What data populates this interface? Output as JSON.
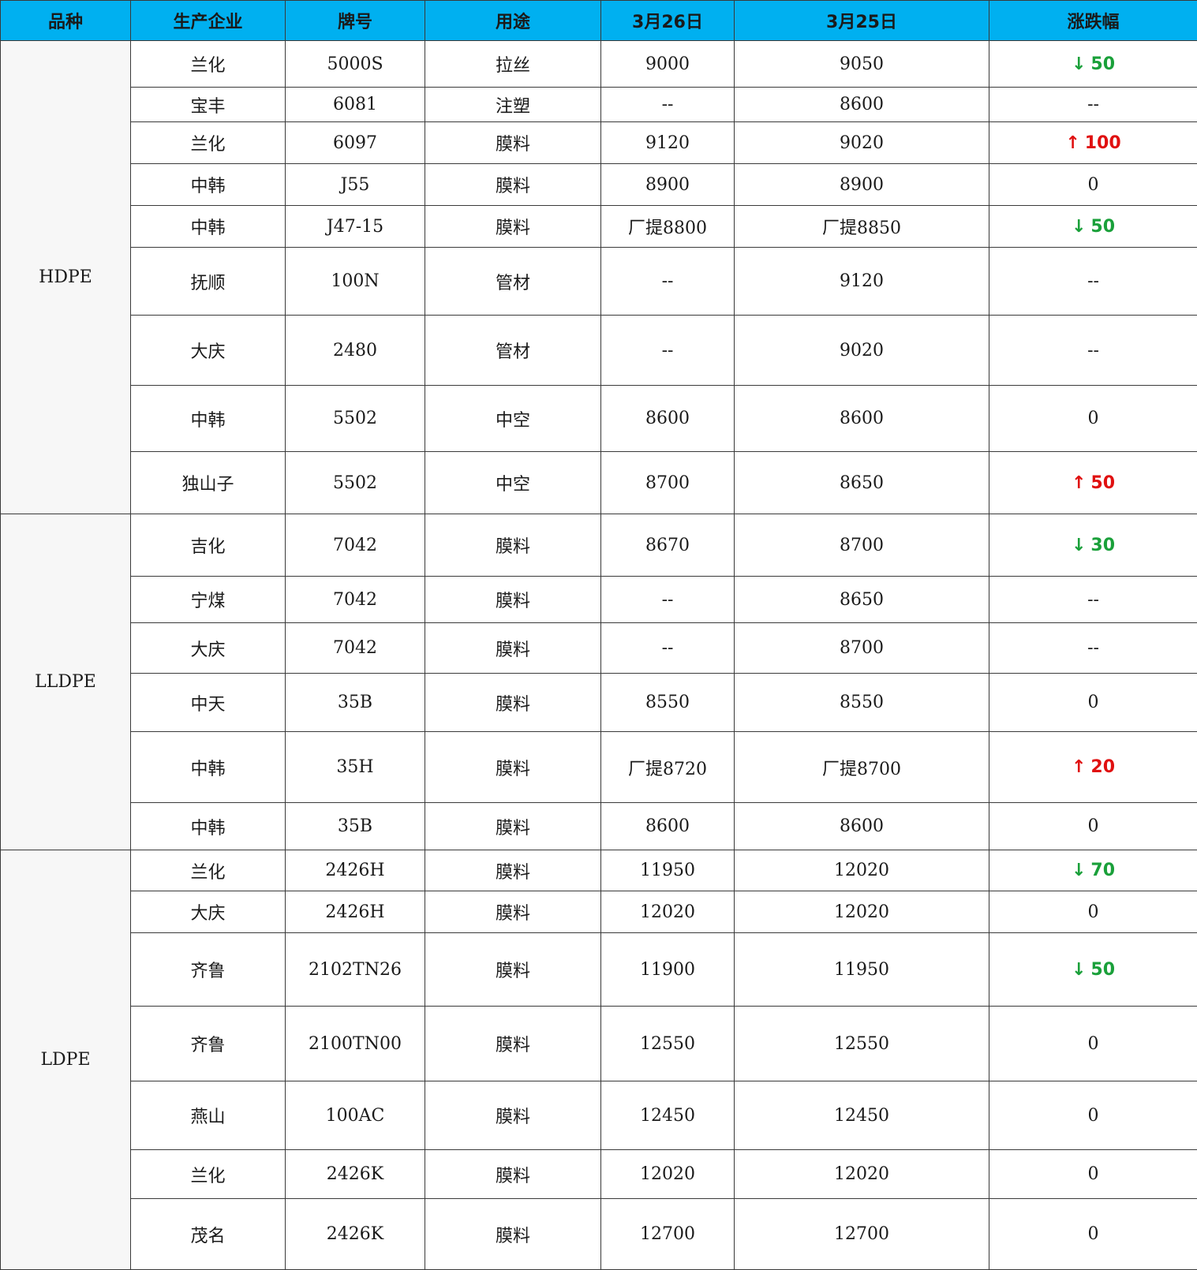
{
  "headers": [
    "品种",
    "生产企业",
    "牌号",
    "用途",
    "3月26日",
    "3月25日",
    "涨跌幅"
  ],
  "groups": [
    {
      "variety": "HDPE",
      "rows": [
        {
          "company": "兰化",
          "grade": "5000S",
          "use": "拉丝",
          "mar26": "9000",
          "mar25": "9050",
          "change": {
            "dir": "down",
            "arrow": "↓",
            "value": "50"
          }
        },
        {
          "company": "宝丰",
          "grade": "6081",
          "use": "注塑",
          "mar26": "--",
          "mar25": "8600",
          "change": {
            "dir": "flat",
            "arrow": "",
            "value": "--"
          }
        },
        {
          "company": "兰化",
          "grade": "6097",
          "use": "膜料",
          "mar26": "9120",
          "mar25": "9020",
          "change": {
            "dir": "up",
            "arrow": "↑",
            "value": "100"
          }
        },
        {
          "company": "中韩",
          "grade": "J55",
          "use": "膜料",
          "mar26": "8900",
          "mar25": "8900",
          "change": {
            "dir": "flat",
            "arrow": "",
            "value": "0"
          }
        },
        {
          "company": "中韩",
          "grade": "J47-15",
          "use": "膜料",
          "mar26": "厂提8800",
          "mar25": "厂提8850",
          "change": {
            "dir": "down",
            "arrow": "↓",
            "value": "50"
          }
        },
        {
          "company": "抚顺",
          "grade": "100N",
          "use": "管材",
          "mar26": "--",
          "mar25": "9120",
          "change": {
            "dir": "flat",
            "arrow": "",
            "value": "--"
          }
        },
        {
          "company": "大庆",
          "grade": "2480",
          "use": "管材",
          "mar26": "--",
          "mar25": "9020",
          "change": {
            "dir": "flat",
            "arrow": "",
            "value": "--"
          }
        },
        {
          "company": "中韩",
          "grade": "5502",
          "use": "中空",
          "mar26": "8600",
          "mar25": "8600",
          "change": {
            "dir": "flat",
            "arrow": "",
            "value": "0"
          }
        },
        {
          "company": "独山子",
          "grade": "5502",
          "use": "中空",
          "mar26": "8700",
          "mar25": "8650",
          "change": {
            "dir": "up",
            "arrow": "↑",
            "value": "50"
          }
        }
      ]
    },
    {
      "variety": "LLDPE",
      "rows": [
        {
          "company": "吉化",
          "grade": "7042",
          "use": "膜料",
          "mar26": "8670",
          "mar25": "8700",
          "change": {
            "dir": "down",
            "arrow": "↓",
            "value": "30"
          }
        },
        {
          "company": "宁煤",
          "grade": "7042",
          "use": "膜料",
          "mar26": "--",
          "mar25": "8650",
          "change": {
            "dir": "flat",
            "arrow": "",
            "value": "--"
          }
        },
        {
          "company": "大庆",
          "grade": "7042",
          "use": "膜料",
          "mar26": "--",
          "mar25": "8700",
          "change": {
            "dir": "flat",
            "arrow": "",
            "value": "--"
          }
        },
        {
          "company": "中天",
          "grade": "35B",
          "use": "膜料",
          "mar26": "8550",
          "mar25": "8550",
          "change": {
            "dir": "flat",
            "arrow": "",
            "value": "0"
          }
        },
        {
          "company": "中韩",
          "grade": "35H",
          "use": "膜料",
          "mar26": "厂提8720",
          "mar25": "厂提8700",
          "change": {
            "dir": "up",
            "arrow": "↑",
            "value": "20"
          }
        },
        {
          "company": "中韩",
          "grade": "35B",
          "use": "膜料",
          "mar26": "8600",
          "mar25": "8600",
          "change": {
            "dir": "flat",
            "arrow": "",
            "value": "0"
          }
        }
      ]
    },
    {
      "variety": "LDPE",
      "rows": [
        {
          "company": "兰化",
          "grade": "2426H",
          "use": "膜料",
          "mar26": "11950",
          "mar25": "12020",
          "change": {
            "dir": "down",
            "arrow": "↓",
            "value": "70"
          }
        },
        {
          "company": "大庆",
          "grade": "2426H",
          "use": "膜料",
          "mar26": "12020",
          "mar25": "12020",
          "change": {
            "dir": "flat",
            "arrow": "",
            "value": "0"
          }
        },
        {
          "company": "齐鲁",
          "grade": "2102TN26",
          "use": "膜料",
          "mar26": "11900",
          "mar25": "11950",
          "change": {
            "dir": "down",
            "arrow": "↓",
            "value": "50"
          }
        },
        {
          "company": "齐鲁",
          "grade": "2100TN00",
          "use": "膜料",
          "mar26": "12550",
          "mar25": "12550",
          "change": {
            "dir": "flat",
            "arrow": "",
            "value": "0"
          }
        },
        {
          "company": "燕山",
          "grade": "100AC",
          "use": "膜料",
          "mar26": "12450",
          "mar25": "12450",
          "change": {
            "dir": "flat",
            "arrow": "",
            "value": "0"
          }
        },
        {
          "company": "兰化",
          "grade": "2426K",
          "use": "膜料",
          "mar26": "12020",
          "mar25": "12020",
          "change": {
            "dir": "flat",
            "arrow": "",
            "value": "0"
          }
        },
        {
          "company": "茂名",
          "grade": "2426K",
          "use": "膜料",
          "mar26": "12700",
          "mar25": "12700",
          "change": {
            "dir": "flat",
            "arrow": "",
            "value": "0"
          }
        }
      ]
    }
  ]
}
